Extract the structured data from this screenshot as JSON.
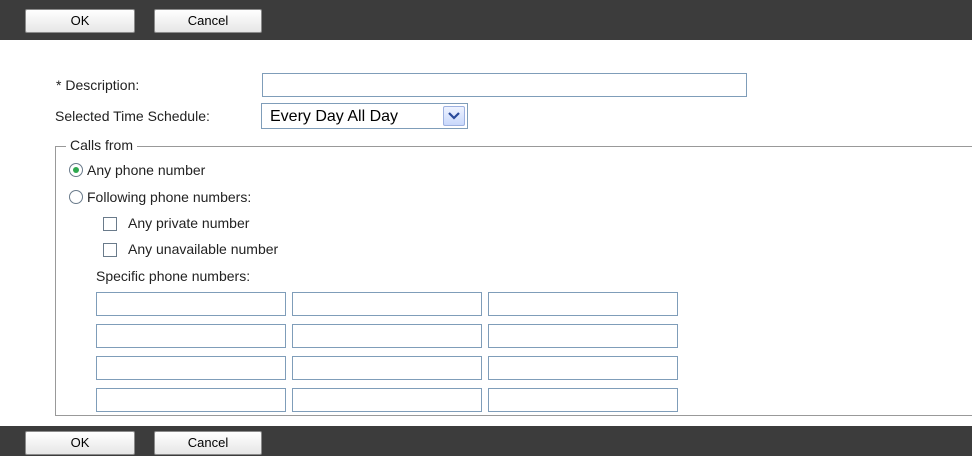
{
  "toolbar": {
    "ok_label": "OK",
    "cancel_label": "Cancel"
  },
  "form": {
    "description_label": "* Description:",
    "description_value": "",
    "schedule_label": "Selected Time Schedule:",
    "schedule_value": "Every Day All Day"
  },
  "calls_from": {
    "legend": "Calls from",
    "any_phone_label": "Any phone number",
    "any_phone_selected": true,
    "following_label": "Following phone numbers:",
    "following_selected": false,
    "private_label": "Any private number",
    "private_checked": false,
    "unavailable_label": "Any unavailable number",
    "unavailable_checked": false,
    "specific_label": "Specific phone numbers:",
    "specific_numbers": [
      "",
      "",
      "",
      "",
      "",
      "",
      "",
      "",
      "",
      "",
      "",
      ""
    ]
  },
  "colors": {
    "bar": "#3c3c3c",
    "radio_selected": "#2fa84f",
    "input_border": "#7f9db9"
  }
}
